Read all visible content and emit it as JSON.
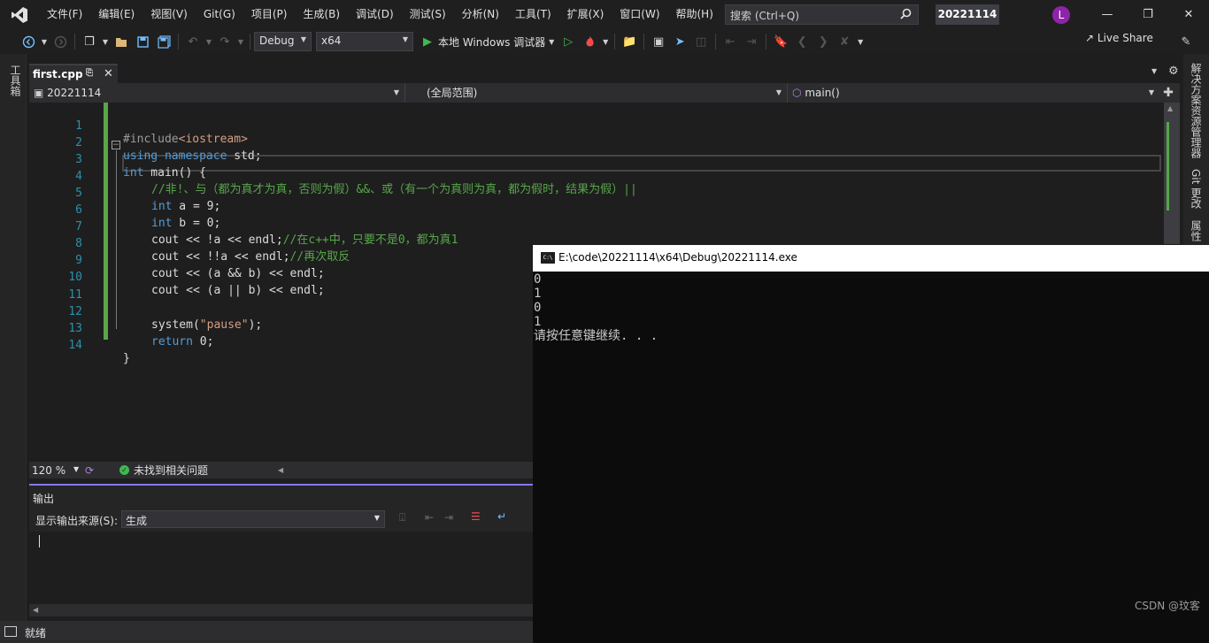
{
  "menu": {
    "items": [
      "文件(F)",
      "编辑(E)",
      "视图(V)",
      "Git(G)",
      "项目(P)",
      "生成(B)",
      "调试(D)",
      "测试(S)",
      "分析(N)",
      "工具(T)",
      "扩展(X)",
      "窗口(W)",
      "帮助(H)"
    ],
    "search_placeholder": "搜索 (Ctrl+Q)",
    "solution_name": "20221114",
    "avatar_initial": "L"
  },
  "toolbar": {
    "configuration": "Debug",
    "platform": "x64",
    "run_label": "本地 Windows 调试器",
    "live_share": "Live Share"
  },
  "left_strip": {
    "toolbox_label": "工具箱"
  },
  "right_strip": {
    "solution_explorer": "解决方案资源管理器",
    "git_changes": "Git 更改",
    "properties": "属性"
  },
  "tabs": [
    {
      "label": "first.cpp"
    }
  ],
  "navbar": {
    "project": "20221114",
    "scope": "(全局范围)",
    "member": "main()"
  },
  "editor": {
    "lines": [
      {
        "n": "1"
      },
      {
        "n": "2"
      },
      {
        "n": "3"
      },
      {
        "n": "4"
      },
      {
        "n": "5"
      },
      {
        "n": "6"
      },
      {
        "n": "7"
      },
      {
        "n": "8"
      },
      {
        "n": "9"
      },
      {
        "n": "10"
      },
      {
        "n": "11"
      },
      {
        "n": "12"
      },
      {
        "n": "13"
      },
      {
        "n": "14"
      }
    ],
    "code": {
      "l1_pp": "#include",
      "l1_inc": "<iostream>",
      "l2_kw1": "using",
      "l2_kw2": "namespace",
      "l2_rest": " std;",
      "l3_kw": "int",
      "l3_rest": " main() {",
      "l4_comment": "//非!、与（都为真才为真，否则为假）&&、或（有一个为真则为真，都为假时，结果为假）||",
      "l5_kw": "int",
      "l5_rest": " a = 9;",
      "l6_kw": "int",
      "l6_rest": " b = 0;",
      "l7_code": "cout << !a << endl;",
      "l7_comment": "//在c++中，只要不是0，都为真1",
      "l8_code": "cout << !!a << endl;",
      "l8_comment": "//再次取反",
      "l9_code": "cout << (a && b) << endl;",
      "l10_code": "cout << (a || b) << endl;",
      "l12_code_a": "system(",
      "l12_str": "\"pause\"",
      "l12_code_b": ");",
      "l13_kw": "return",
      "l13_rest": " 0;",
      "l14_code": "}"
    }
  },
  "editor_status": {
    "zoom": "120 %",
    "issues": "未找到相关问题"
  },
  "output": {
    "title": "输出",
    "source_label": "显示输出来源(S):",
    "source_value": "生成"
  },
  "status_bar": {
    "text": "就绪"
  },
  "console": {
    "title": "E:\\code\\20221114\\x64\\Debug\\20221114.exe",
    "lines": [
      "0",
      "1",
      "0",
      "1",
      "请按任意键继续. . ."
    ],
    "watermark": "CSDN @玟客"
  }
}
